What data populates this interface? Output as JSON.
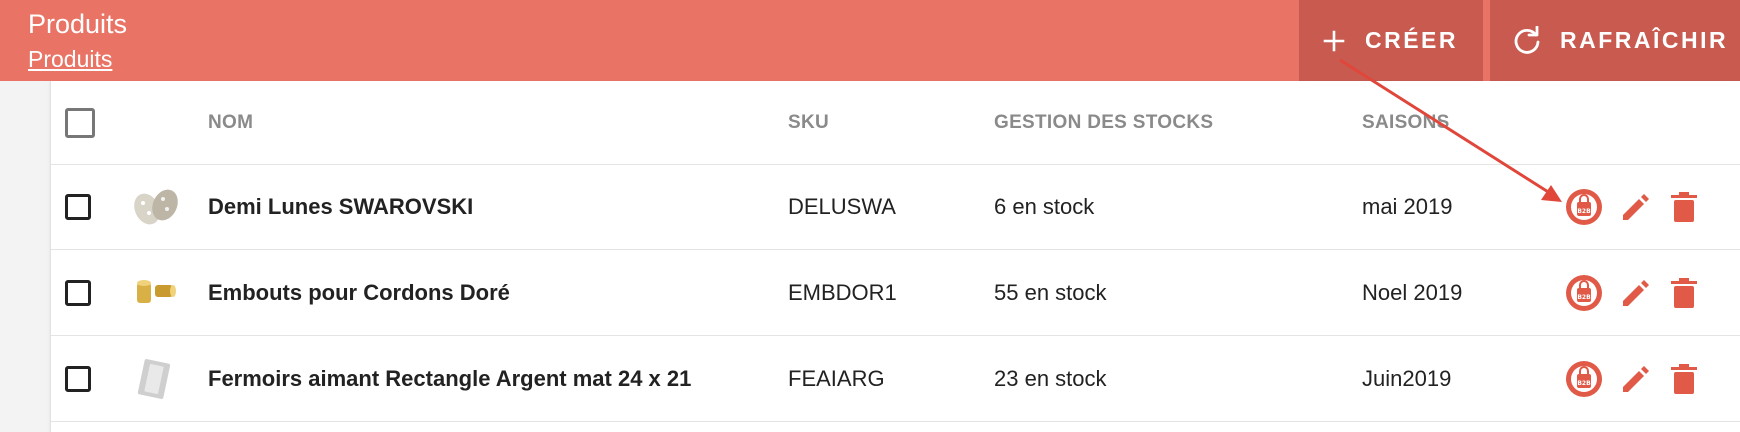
{
  "header": {
    "title": "Produits",
    "breadcrumb": "Produits",
    "create_label": "CRÉER",
    "refresh_label": "RAFRAÎCHIR",
    "create_icon": "plus-icon",
    "refresh_icon": "refresh-icon"
  },
  "table": {
    "columns": [
      "NOM",
      "SKU",
      "GESTION DES STOCKS",
      "SAISONS"
    ],
    "rows": [
      {
        "name": "Demi Lunes SWAROVSKI",
        "sku": "DELUSWA",
        "stock": "6 en stock",
        "season": "mai 2019",
        "thumb_icon": "crystal-half-moon-image"
      },
      {
        "name": "Embouts pour Cordons Doré",
        "sku": "EMBDOR1",
        "stock": "55 en stock",
        "season": "Noel 2019",
        "thumb_icon": "gold-end-caps-image"
      },
      {
        "name": "Fermoirs aimant Rectangle Argent mat 24 x 21",
        "sku": "FEAIARG",
        "stock": "23 en stock",
        "season": "Juin2019",
        "thumb_icon": "silver-clasp-image"
      }
    ],
    "row_actions": {
      "b2b_icon": "b2b-bag-icon",
      "edit_icon": "pencil-icon",
      "delete_icon": "trash-icon",
      "b2b_badge": "B2B"
    }
  },
  "colors": {
    "header_bg": "#e97466",
    "header_button_bg": "#c85a50",
    "accent": "#e05a47",
    "annotation_arrow": "#e0473a"
  }
}
